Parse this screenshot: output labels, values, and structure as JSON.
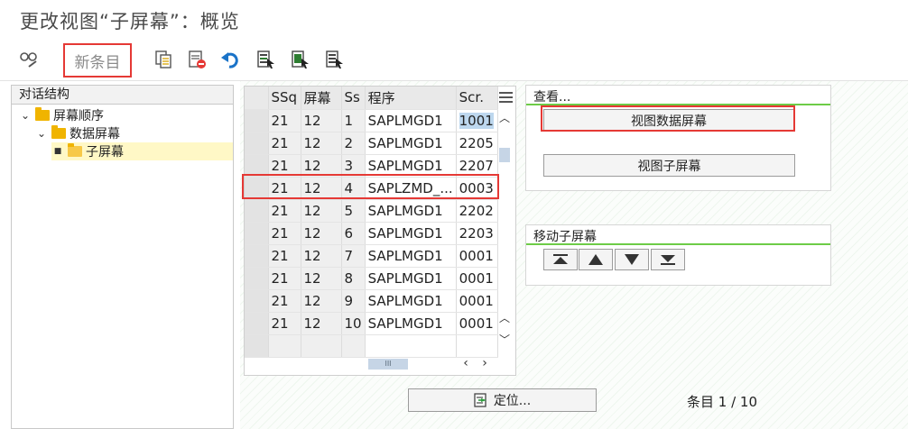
{
  "title": "更改视图“子屏幕”：概览",
  "toolbar": {
    "new_entry_label": "新条目",
    "icons": [
      "glasses-pencil-icon",
      "copy-icon",
      "delete-icon",
      "undo-icon",
      "select-all-icon",
      "select-block-icon",
      "deselect-all-icon"
    ]
  },
  "tree": {
    "header": "对话结构",
    "items": [
      {
        "label": "屏幕顺序",
        "level": 1
      },
      {
        "label": "数据屏幕",
        "level": 2
      },
      {
        "label": "子屏幕",
        "level": 3
      }
    ]
  },
  "grid": {
    "headers": [
      "SSq",
      "屏幕",
      "Ss",
      "程序",
      "Scr."
    ],
    "rows": [
      {
        "ssq": "21",
        "screen": "12",
        "ss": "1",
        "program": "SAPLMGD1",
        "scr": "1001"
      },
      {
        "ssq": "21",
        "screen": "12",
        "ss": "2",
        "program": "SAPLMGD1",
        "scr": "2205"
      },
      {
        "ssq": "21",
        "screen": "12",
        "ss": "3",
        "program": "SAPLMGD1",
        "scr": "2207"
      },
      {
        "ssq": "21",
        "screen": "12",
        "ss": "4",
        "program": "SAPLZMD_...",
        "scr": "0003"
      },
      {
        "ssq": "21",
        "screen": "12",
        "ss": "5",
        "program": "SAPLMGD1",
        "scr": "2202"
      },
      {
        "ssq": "21",
        "screen": "12",
        "ss": "6",
        "program": "SAPLMGD1",
        "scr": "2203"
      },
      {
        "ssq": "21",
        "screen": "12",
        "ss": "7",
        "program": "SAPLMGD1",
        "scr": "0001"
      },
      {
        "ssq": "21",
        "screen": "12",
        "ss": "8",
        "program": "SAPLMGD1",
        "scr": "0001"
      },
      {
        "ssq": "21",
        "screen": "12",
        "ss": "9",
        "program": "SAPLMGD1",
        "scr": "0001"
      },
      {
        "ssq": "21",
        "screen": "12",
        "ss": "10",
        "program": "SAPLMGD1",
        "scr": "0001"
      }
    ],
    "hscroll_label": "III"
  },
  "view_panel": {
    "title": "查看...",
    "view_data_screen_label": "视图数据屏幕",
    "view_subscreen_label": "视图子屏幕"
  },
  "move_panel": {
    "title": "移动子屏幕"
  },
  "footer": {
    "locate_label": "定位...",
    "entry_count": "条目 1 / 10"
  },
  "colors": {
    "highlight_red": "#e53935",
    "section_green": "#6dcc47",
    "cell_selected": "#bdd7ee",
    "folder_yellow": "#f0b400"
  }
}
